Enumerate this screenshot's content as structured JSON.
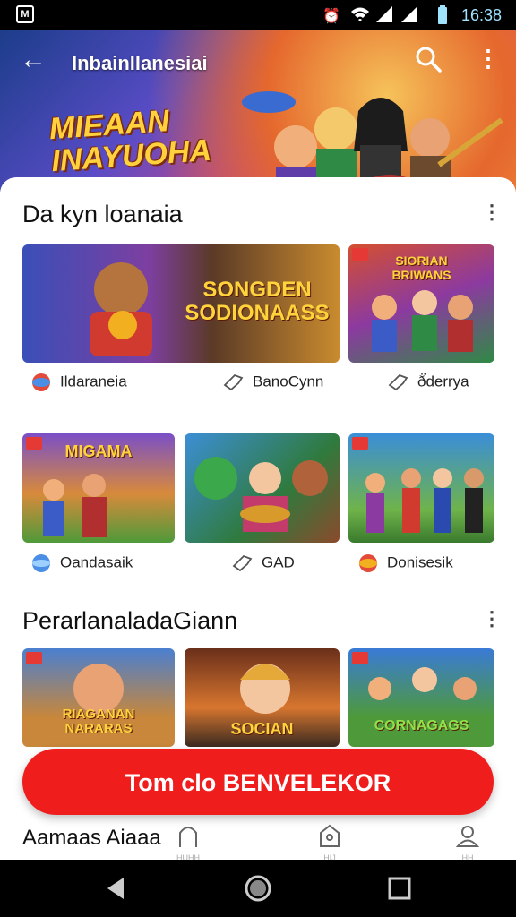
{
  "status_bar": {
    "time": "16:38"
  },
  "header": {
    "title": "Inbainllanesiai",
    "logo_text": "MIEAAN\nINAYUOHA"
  },
  "section1": {
    "title": "Da kyn loanaia"
  },
  "row1": [
    {
      "card_text": "SONGDEN\nSODIONAASS",
      "label": "Ildaraneia",
      "label_icon": "globe-icon"
    },
    {
      "card_text": "",
      "label": "BanoCynn",
      "label_icon": "pointer-icon"
    },
    {
      "card_text": "SIORIAN\nBRIWANS",
      "label": "ð̈derrya",
      "label_icon": "pointer-icon"
    }
  ],
  "row2": [
    {
      "card_text": "MIGAMA",
      "label": "Oandasaik",
      "label_icon": "globe-icon"
    },
    {
      "card_text": "",
      "label": "GAD",
      "label_icon": "pointer-icon"
    },
    {
      "card_text": "",
      "label": "Donisesik",
      "label_icon": "globe-icon"
    }
  ],
  "section2": {
    "title": "PerarlanaladaGiann"
  },
  "row3": [
    {
      "card_text": "RIAGANAN\nNARARAS"
    },
    {
      "card_text": "SOCIAN"
    },
    {
      "card_text": "CORNAGAGS"
    }
  ],
  "cta": {
    "label": "Tom clo BENVELEKOR"
  },
  "bottom": {
    "label": "Aamaas Aiaaa",
    "tabs": [
      {
        "name": "home",
        "caption": "HUHH"
      },
      {
        "name": "store",
        "caption": "HIJ"
      },
      {
        "name": "profile",
        "caption": "HH"
      }
    ]
  },
  "colors": {
    "accent": "#f01d1d",
    "status_time": "#9fe3ff"
  }
}
